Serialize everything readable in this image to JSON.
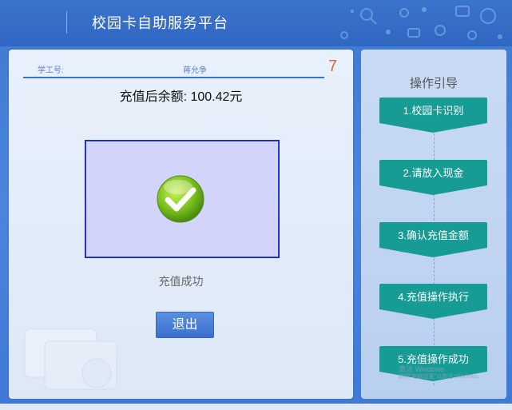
{
  "header": {
    "title": "校园卡自助服务平台"
  },
  "info": {
    "student_id_label": "学工号:",
    "student_name": "蒋允争",
    "countdown": "7"
  },
  "balance": {
    "text": "充值后余额: 100.42元"
  },
  "status": {
    "message": "充值成功"
  },
  "actions": {
    "exit_label": "退出"
  },
  "guide": {
    "title": "操作引导",
    "steps": [
      {
        "label": "1.校园卡识别"
      },
      {
        "label": "2.请放入现金"
      },
      {
        "label": "3.确认充值金额"
      },
      {
        "label": "4.充值操作执行"
      },
      {
        "label": "5.充值操作成功"
      }
    ]
  },
  "watermark": {
    "line1": "激活 Windows",
    "line2": "转到\"电脑设置\"以激活 Windows。"
  },
  "colors": {
    "header_bg": "#2f66c2",
    "step_teal": "#169c95",
    "countdown": "#e06a2c",
    "success_box_bg": "#d3d4fb"
  }
}
